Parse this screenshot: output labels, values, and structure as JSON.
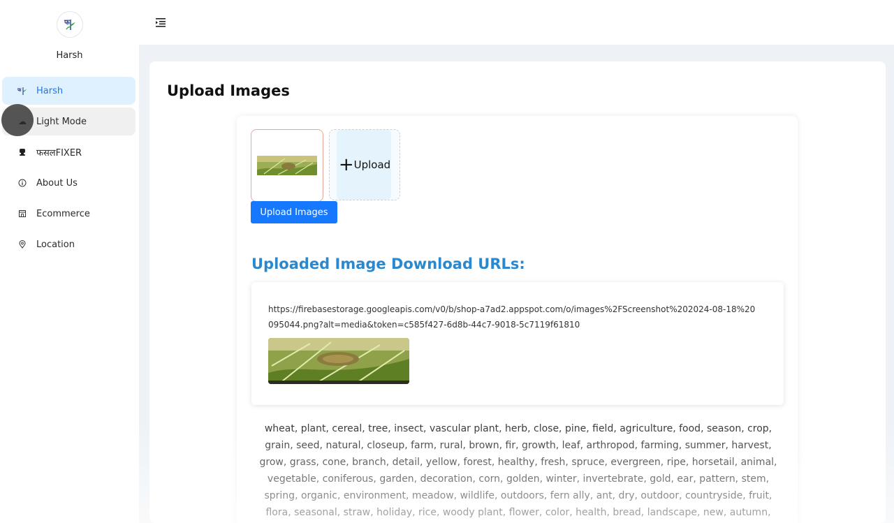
{
  "sidebar": {
    "brand_name": "Harsh",
    "logo_icon": "leaf-logo-icon",
    "items": [
      {
        "label": "Harsh",
        "icon": "leaf-logo-icon",
        "active": true
      },
      {
        "label": "Light Mode",
        "icon": "weather-icon",
        "active": false
      },
      {
        "label": "फसलFIXER",
        "icon": "robot-icon",
        "active": false
      },
      {
        "label": "About Us",
        "icon": "info-icon",
        "active": false
      },
      {
        "label": "Ecommerce",
        "icon": "shop-icon",
        "active": false
      },
      {
        "label": "Location",
        "icon": "location-pin-icon",
        "active": false
      }
    ]
  },
  "header": {
    "menu_icon": "menu-fold-icon"
  },
  "main": {
    "title": "Upload Images",
    "upload": {
      "add_label": "Upload",
      "button_label": "Upload Images"
    },
    "urls_heading": "Uploaded Image Download URLs:",
    "url": "https://firebasestorage.googleapis.com/v0/b/shop-a7ad2.appspot.com/o/images%2FScreenshot%202024-08-18%20095044.png?alt=media&token=c585f427-6d8b-44c7-9018-5c7119f61810",
    "tags": "wheat, plant, cereal, tree, insect, vascular plant, herb, close, pine, field, agriculture, food, season, crop, grain, seed, natural, closeup, farm, rural, brown, fir, growth, leaf, arthropod, farming, summer, harvest, grow, grass, cone, branch, detail, yellow, forest, healthy, fresh, spruce, evergreen, ripe, horsetail, animal, vegetable, coniferous, garden, decoration, corn, golden, winter, invertebrate, gold, ear, pattern, stem, spring, organic, environment, meadow, wildlife, outdoors, fern ally, ant, dry, outdoor, countryside, fruit, flora, seasonal, straw, holiday, rice, woody plant, flower, color, health, bread, landscape, new, autumn, bright, day, wild, rye,"
  },
  "colors": {
    "accent": "#1677ff",
    "heading_blue": "#2a88cf",
    "active_bg": "#dff0ff"
  }
}
